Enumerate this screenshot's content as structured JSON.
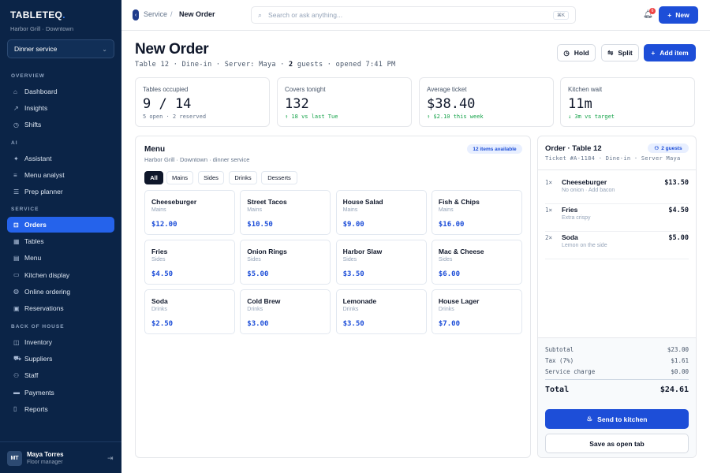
{
  "colors": {
    "sidebar_bg": "#0b2447",
    "accent": "#1d4ed8",
    "positive": "#16a34a",
    "danger": "#ef4444"
  },
  "sidebar": {
    "logo": "TABLETEQ",
    "location": "Harbor Grill · Downtown",
    "service_select": "Dinner service",
    "sections": [
      {
        "title": "OVERVIEW",
        "items": [
          {
            "label": "Dashboard",
            "icon": "home-icon"
          },
          {
            "label": "Insights",
            "icon": "chart-icon"
          },
          {
            "label": "Shifts",
            "icon": "clock-icon"
          }
        ]
      },
      {
        "title": "AI",
        "items": [
          {
            "label": "Assistant",
            "icon": "sparkle-icon"
          },
          {
            "label": "Menu analyst",
            "icon": "sliders-icon"
          },
          {
            "label": "Prep planner",
            "icon": "list-icon"
          }
        ]
      },
      {
        "title": "SERVICE",
        "items": [
          {
            "label": "Orders",
            "icon": "cart-icon",
            "active": true
          },
          {
            "label": "Tables",
            "icon": "table-icon"
          },
          {
            "label": "Menu",
            "icon": "menu-icon"
          },
          {
            "label": "Kitchen display",
            "icon": "monitor-icon"
          },
          {
            "label": "Online ordering",
            "icon": "globe-icon"
          },
          {
            "label": "Reservations",
            "icon": "calendar-icon"
          }
        ]
      },
      {
        "title": "BACK OF HOUSE",
        "items": [
          {
            "label": "Inventory",
            "icon": "box-icon"
          },
          {
            "label": "Suppliers",
            "icon": "truck-icon"
          },
          {
            "label": "Staff",
            "icon": "people-icon"
          },
          {
            "label": "Payments",
            "icon": "card-icon"
          },
          {
            "label": "Reports",
            "icon": "document-icon"
          }
        ]
      }
    ],
    "user": {
      "initials": "MT",
      "name": "Maya Torres",
      "role": "Floor manager"
    }
  },
  "topbar": {
    "breadcrumb": [
      "Service",
      "/",
      "New Order"
    ],
    "search_placeholder": "Search or ask anything...",
    "search_shortcut": "⌘K",
    "notifications": "6",
    "new_label": "New"
  },
  "page": {
    "title": "New Order",
    "subtitle_pre": "Table 12 · Dine-in · Server: Maya · ",
    "guests_count": "2",
    "subtitle_post": " guests · opened 7:41 PM",
    "actions": {
      "hold": "Hold",
      "split": "Split",
      "add_item": "Add item"
    }
  },
  "stats": [
    {
      "label": "Tables occupied",
      "value": "9 / 14",
      "note": "5 open · 2 reserved",
      "tone": "neutral"
    },
    {
      "label": "Covers tonight",
      "value": "132",
      "note": "↑ 18 vs last Tue",
      "tone": "green"
    },
    {
      "label": "Average ticket",
      "value": "$38.40",
      "note": "↑ $2.10 this week",
      "tone": "green"
    },
    {
      "label": "Kitchen wait",
      "value": "11m",
      "note": "↓ 3m vs target",
      "tone": "green"
    }
  ],
  "menu": {
    "title": "Menu",
    "subtitle": "Harbor Grill · Downtown · dinner service",
    "badge": "12 items available",
    "tabs": [
      "All",
      "Mains",
      "Sides",
      "Drinks",
      "Desserts"
    ],
    "active_tab": "All",
    "items": [
      {
        "name": "Cheeseburger",
        "category": "Mains",
        "price": "$12.00"
      },
      {
        "name": "Street Tacos",
        "category": "Mains",
        "price": "$10.50"
      },
      {
        "name": "House Salad",
        "category": "Mains",
        "price": "$9.00"
      },
      {
        "name": "Fish & Chips",
        "category": "Mains",
        "price": "$16.00"
      },
      {
        "name": "Fries",
        "category": "Sides",
        "price": "$4.50"
      },
      {
        "name": "Onion Rings",
        "category": "Sides",
        "price": "$5.00"
      },
      {
        "name": "Harbor Slaw",
        "category": "Sides",
        "price": "$3.50"
      },
      {
        "name": "Mac & Cheese",
        "category": "Sides",
        "price": "$6.00"
      },
      {
        "name": "Soda",
        "category": "Drinks",
        "price": "$2.50"
      },
      {
        "name": "Cold Brew",
        "category": "Drinks",
        "price": "$3.00"
      },
      {
        "name": "Lemonade",
        "category": "Drinks",
        "price": "$3.50"
      },
      {
        "name": "House Lager",
        "category": "Drinks",
        "price": "$7.00"
      }
    ]
  },
  "order": {
    "title": "Order · Table 12",
    "guests_badge": "2 guests",
    "ticket": "Ticket #A-1184 · Dine-in · Server Maya",
    "lines": [
      {
        "qty": "1×",
        "name": "Cheeseburger",
        "modifiers": "No onion · Add bacon",
        "price": "$13.50"
      },
      {
        "qty": "1×",
        "name": "Fries",
        "modifiers": "Extra crispy",
        "price": "$4.50"
      },
      {
        "qty": "2×",
        "name": "Soda",
        "modifiers": "Lemon on the side",
        "price": "$5.00"
      }
    ],
    "subtotal_label": "Subtotal",
    "subtotal": "$23.00",
    "tax_label": "Tax (7%)",
    "tax": "$1.61",
    "service_label": "Service charge",
    "service": "$0.00",
    "total_label": "Total",
    "total": "$24.61",
    "send_label": "Send to kitchen",
    "save_label": "Save as open tab"
  }
}
